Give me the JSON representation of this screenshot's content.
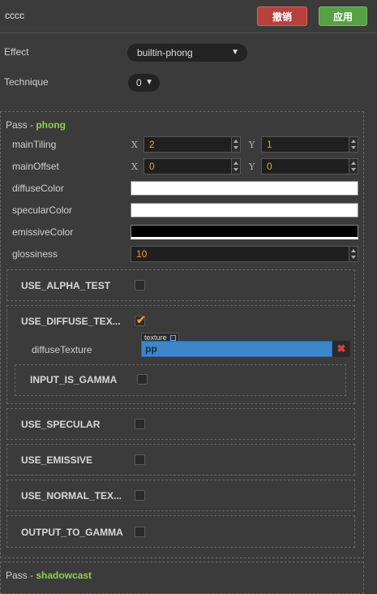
{
  "header": {
    "title": "cccc",
    "revert_label": "撤销",
    "apply_label": "应用"
  },
  "effect": {
    "label": "Effect",
    "value": "builtin-phong"
  },
  "technique": {
    "label": "Technique",
    "value": "0"
  },
  "pass1": {
    "prefix": "Pass - ",
    "name": "phong",
    "props": {
      "mainTiling": {
        "label": "mainTiling",
        "x_axis": "X",
        "x": "2",
        "y_axis": "Y",
        "y": "1"
      },
      "mainOffset": {
        "label": "mainOffset",
        "x_axis": "X",
        "x": "0",
        "y_axis": "Y",
        "y": "0"
      },
      "diffuseColor": {
        "label": "diffuseColor",
        "color": "#ffffff"
      },
      "specularColor": {
        "label": "specularColor",
        "color": "#ffffff"
      },
      "emissiveColor": {
        "label": "emissiveColor",
        "color": "#000000"
      },
      "glossiness": {
        "label": "glossiness",
        "value": "10"
      }
    },
    "defines": {
      "alpha_test": {
        "label": "USE_ALPHA_TEST",
        "checked": false
      },
      "diffuse_texture": {
        "label": "USE_DIFFUSE_TEX...",
        "checked": true,
        "texture": {
          "label": "diffuseTexture",
          "tag": "texture",
          "value": "pp"
        },
        "input_is_gamma": {
          "label": "INPUT_IS_GAMMA",
          "checked": false
        }
      },
      "specular": {
        "label": "USE_SPECULAR",
        "checked": false
      },
      "emissive": {
        "label": "USE_EMISSIVE",
        "checked": false
      },
      "normal_texture": {
        "label": "USE_NORMAL_TEX...",
        "checked": false
      },
      "output_to_gamma": {
        "label": "OUTPUT_TO_GAMMA",
        "checked": false
      }
    }
  },
  "pass2": {
    "prefix": "Pass - ",
    "name": "shadowcast"
  },
  "colors": {
    "revert": "#b8403d",
    "apply": "#57a043",
    "accent": "#f0a030",
    "pass_name": "#8fd14f",
    "asset_field": "#3c86c9"
  }
}
